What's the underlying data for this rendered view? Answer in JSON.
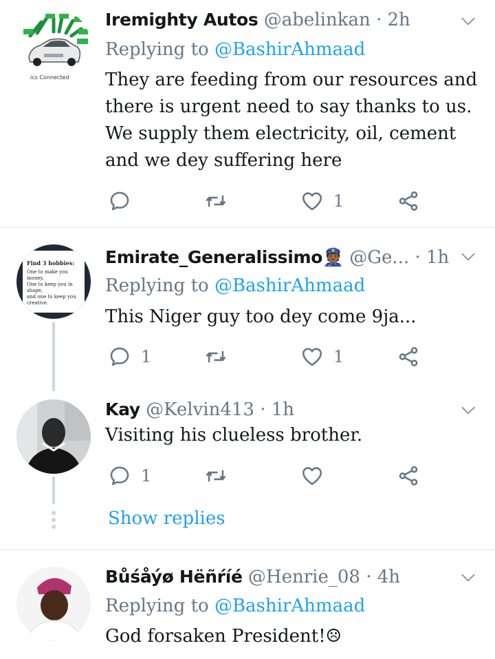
{
  "tweets": [
    {
      "name": "Iremighty Autos",
      "handle": "@abelinkan",
      "dot": "·",
      "time": "2h",
      "replying_label": "Replying to",
      "replying_handle": "@BashirAhmaad",
      "lines": [
        "They are feeding from our resources and",
        "there is urgent need to say thanks to us.",
        "We supply them electricity, oil, cement",
        "and we dey suffering here"
      ],
      "reply_count": "",
      "retweet_count": "",
      "like_count": "1",
      "avatar_caption": "ics Connected"
    },
    {
      "name": "Emirate_Generalissimo👮🏾",
      "handle": "@Ge...",
      "dot": "·",
      "time": "1h",
      "replying_label": "Replying to",
      "replying_handle": "@BashirAhmaad",
      "lines": [
        "This Niger guy too dey come 9ja..."
      ],
      "reply_count": "1",
      "retweet_count": "",
      "like_count": "1",
      "avatar_text": [
        "Find 3 hobbies:",
        "One to make you money,",
        "One to keep you in shape,",
        "and one to keep you creative."
      ]
    },
    {
      "name": "Kay",
      "handle": "@Kelvin413",
      "dot": "·",
      "time": "1h",
      "lines": [
        "Visiting his clueless brother."
      ],
      "reply_count": "1",
      "retweet_count": "",
      "like_count": ""
    },
    {
      "name": "Bůśåýø Hëñŕíé",
      "handle": "@Henrie_08",
      "dot": "·",
      "time": "4h",
      "replying_label": "Replying to",
      "replying_handle": "@BashirAhmaad",
      "lines": [
        "God forsaken President!☹"
      ]
    }
  ],
  "show_replies": "Show replies",
  "colors": {
    "link": "#1da1f2",
    "muted": "#657786",
    "text": "#14171a",
    "divider": "#e1e8ed"
  }
}
